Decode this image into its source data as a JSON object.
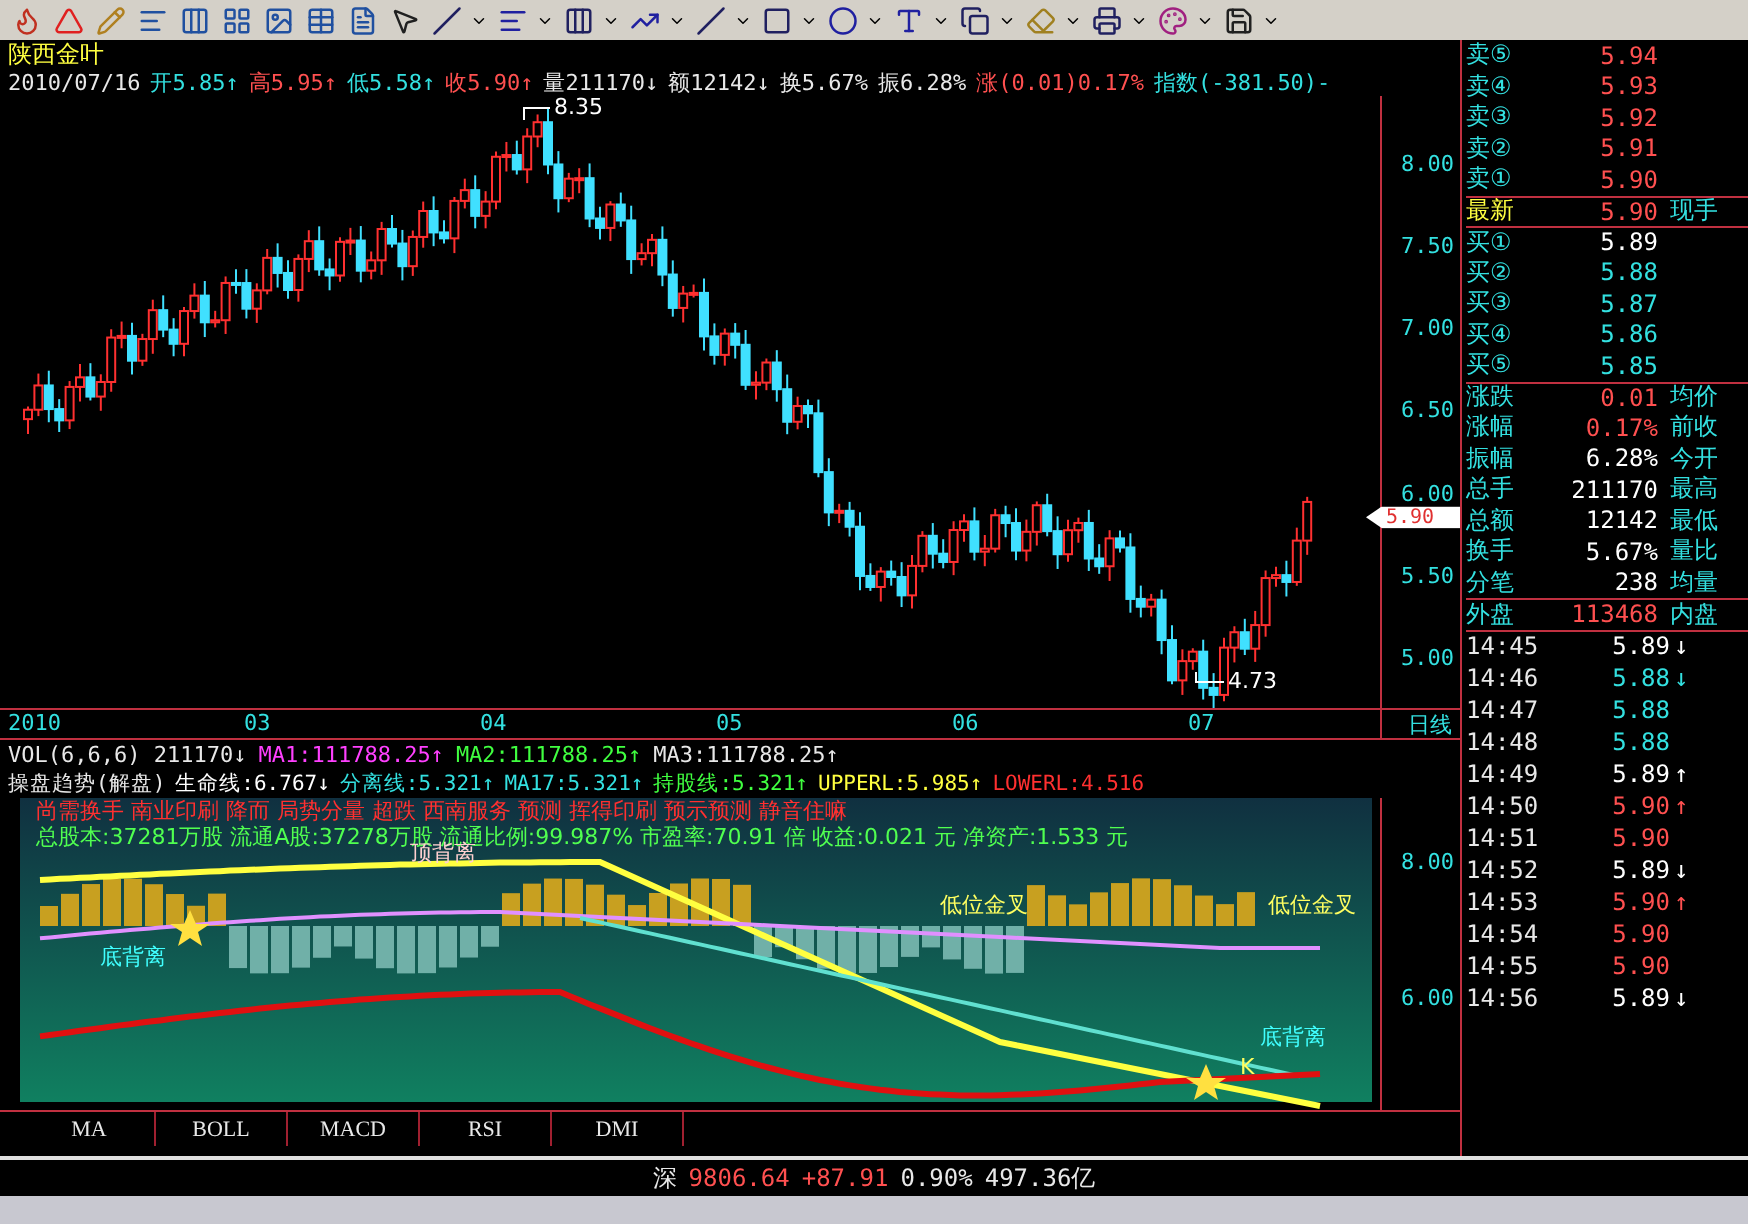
{
  "stock": {
    "name": "陕西金叶",
    "date": "2010/07/16",
    "quote": [
      {
        "text": "开5.85↑",
        "color": "#33e0e0"
      },
      {
        "text": "高5.95↑",
        "color": "#ff5050"
      },
      {
        "text": "低5.58↑",
        "color": "#33e0e0"
      },
      {
        "text": "收5.90↑",
        "color": "#ff5050"
      },
      {
        "text": "量211170↓",
        "color": "#e8e8e8"
      },
      {
        "text": "额12142↓",
        "color": "#e8e8e8"
      },
      {
        "text": "换5.67%",
        "color": "#e8e8e8"
      },
      {
        "text": "振6.28%",
        "color": "#e8e8e8"
      },
      {
        "text": "涨(0.01)0.17%",
        "color": "#ff5050"
      },
      {
        "text": "指数(-381.50)-",
        "color": "#33e0e0"
      }
    ]
  },
  "main_chart": {
    "price_ticks": [
      "8.00",
      "7.50",
      "7.00",
      "6.50",
      "6.00",
      "5.50",
      "5.00"
    ],
    "high_label": "8.35",
    "low_label": "4.73",
    "last_price": "5.90"
  },
  "time_axis": {
    "labels": [
      "2010",
      "03",
      "04",
      "05",
      "06",
      "07"
    ],
    "period": "日线"
  },
  "volume_line": [
    {
      "text": "VOL(6,6,6) 211170↓",
      "color": "#e8e8e8"
    },
    {
      "text": "MA1:111788.25↑",
      "color": "#ff40ff"
    },
    {
      "text": "MA2:111788.25↑",
      "color": "#40ff40"
    },
    {
      "text": "MA3:111788.25↑",
      "color": "#e8e8e8"
    }
  ],
  "indicator_line": [
    {
      "text": "操盘趋势(解盘)",
      "color": "#e8e8e8"
    },
    {
      "text": "生命线:6.767↓",
      "color": "#ffffff"
    },
    {
      "text": "分离线:5.321↑",
      "color": "#33e0e0"
    },
    {
      "text": "MA17:5.321↑",
      "color": "#33e0e0"
    },
    {
      "text": "持股线:5.321↑",
      "color": "#40ff40"
    },
    {
      "text": "UPPERL:5.985↑",
      "color": "#ffff40"
    },
    {
      "text": "LOWERL:4.516",
      "color": "#ff3030"
    }
  ],
  "lower_panel": {
    "signals": "尚需换手 南业印刷 降而 局势分量 超跌 西南服务 预测 挥得印刷 预示预测 静音住嘛",
    "fundamentals": "总股本:37281万股  流通A股:37278万股  流通比例:99.987%  市盈率:70.91 倍  收益:0.021 元  净资产:1.533 元",
    "ticks": [
      "8.00",
      "6.00"
    ],
    "labels": [
      {
        "text": "底背离",
        "color": "#40ffff"
      },
      {
        "text": "顶背离",
        "color": "#ffd0d0"
      },
      {
        "text": "低位金叉",
        "color": "#ffff60"
      },
      {
        "text": "低位金叉",
        "color": "#ffff60"
      },
      {
        "text": "底背离",
        "color": "#40ffff"
      },
      {
        "text": "K",
        "color": "#ffff60"
      }
    ]
  },
  "tabs": [
    {
      "label": "MA",
      "selected": false
    },
    {
      "label": "BOLL",
      "selected": false
    },
    {
      "label": "MACD",
      "selected": false
    },
    {
      "label": "RSI",
      "selected": false
    },
    {
      "label": "DMI",
      "selected": false
    }
  ],
  "order_book": {
    "asks": [
      {
        "label": "卖⑤",
        "price": "5.94"
      },
      {
        "label": "卖④",
        "price": "5.93"
      },
      {
        "label": "卖③",
        "price": "5.92"
      },
      {
        "label": "卖②",
        "price": "5.91"
      },
      {
        "label": "卖①",
        "price": "5.90"
      }
    ],
    "last": {
      "label": "最新",
      "price": "5.90",
      "extra": "现手"
    },
    "bids": [
      {
        "label": "买①",
        "price": "5.89",
        "color": "#ffffff"
      },
      {
        "label": "买②",
        "price": "5.88",
        "color": "#33e0e0"
      },
      {
        "label": "买③",
        "price": "5.87",
        "color": "#33e0e0"
      },
      {
        "label": "买④",
        "price": "5.86",
        "color": "#33e0e0"
      },
      {
        "label": "买⑤",
        "price": "5.85",
        "color": "#33e0e0"
      }
    ],
    "stats": [
      {
        "label": "涨跌",
        "value": "0.01",
        "extra": "均价",
        "color": "#ff5050"
      },
      {
        "label": "涨幅",
        "value": "0.17%",
        "extra": "前收",
        "color": "#ff5050"
      },
      {
        "label": "振幅",
        "value": "6.28%",
        "extra": "今开",
        "color": "#ffffff"
      },
      {
        "label": "总手",
        "value": "211170",
        "extra": "最高",
        "color": "#ffffff"
      },
      {
        "label": "总额",
        "value": "12142",
        "extra": "最低",
        "color": "#ffffff"
      },
      {
        "label": "换手",
        "value": "5.67%",
        "extra": "量比",
        "color": "#ffffff"
      },
      {
        "label": "分笔",
        "value": "238",
        "extra": "均量",
        "color": "#ffffff"
      }
    ],
    "outer": {
      "label": "外盘",
      "value": "113468",
      "extra": "内盘"
    }
  },
  "ticks": [
    {
      "time": "14:45",
      "price": "5.89",
      "arrow": "↓",
      "color": "#ffffff"
    },
    {
      "time": "14:46",
      "price": "5.88",
      "arrow": "↓",
      "color": "#33e0e0"
    },
    {
      "time": "14:47",
      "price": "5.88",
      "color": "#33e0e0"
    },
    {
      "time": "14:48",
      "price": "5.88",
      "color": "#33e0e0"
    },
    {
      "time": "14:49",
      "price": "5.89",
      "arrow": "↑",
      "color": "#ffffff"
    },
    {
      "time": "14:50",
      "price": "5.90",
      "arrow": "↑",
      "color": "#ff5050"
    },
    {
      "time": "14:51",
      "price": "5.90",
      "color": "#ff5050"
    },
    {
      "time": "14:52",
      "price": "5.89",
      "arrow": "↓",
      "color": "#ffffff"
    },
    {
      "time": "14:53",
      "price": "5.90",
      "arrow": "↑",
      "color": "#ff5050"
    },
    {
      "time": "14:54",
      "price": "5.90",
      "color": "#ff5050"
    },
    {
      "time": "14:55",
      "price": "5.90",
      "color": "#ff5050"
    },
    {
      "time": "14:56",
      "price": "5.89",
      "arrow": "↓",
      "color": "#ffffff"
    }
  ],
  "status_bar": {
    "index_name": "深",
    "value": "9806.64",
    "change": "+87.91",
    "percent": "0.90%",
    "turnover": "497.36亿"
  }
}
